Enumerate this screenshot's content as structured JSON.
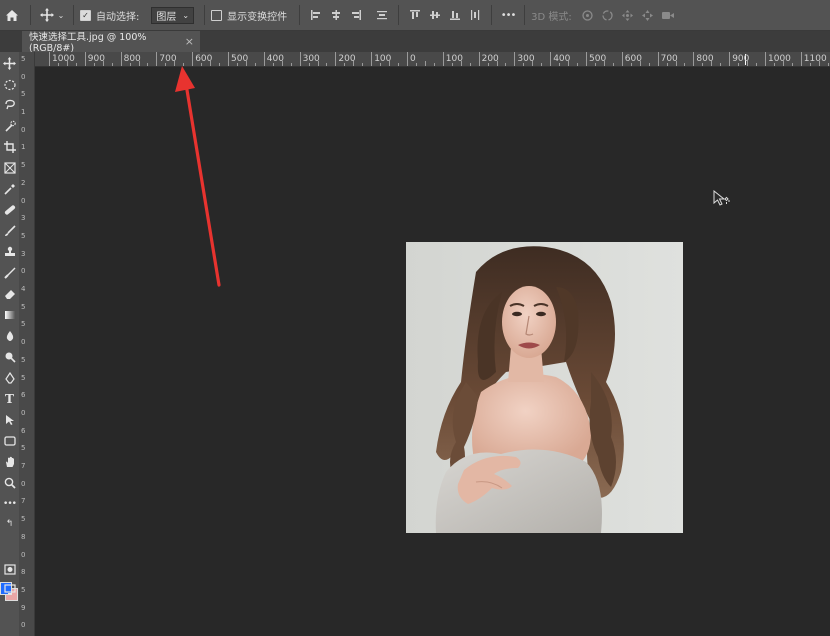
{
  "options_bar": {
    "auto_select_label": "自动选择:",
    "auto_select_checked": true,
    "layer_dropdown_value": "图层",
    "show_transform_label": "显示变换控件",
    "show_transform_checked": false,
    "mode_3d_label": "3D 模式:",
    "more_label": "•••"
  },
  "document_tab": {
    "title": "快速选择工具.jpg @ 100%(RGB/8#)",
    "close_label": "×"
  },
  "ruler": {
    "h_labels": [
      "1000",
      "900",
      "800",
      "700",
      "600",
      "500",
      "400",
      "300",
      "200",
      "100",
      "0",
      "100",
      "200",
      "300",
      "400",
      "500",
      "600",
      "700",
      "800",
      "900",
      "1000",
      "1100"
    ],
    "v_labels": [
      "5",
      "0",
      "5",
      "1",
      "0",
      "1",
      "5",
      "2",
      "0",
      "3",
      "5",
      "3",
      "0",
      "4",
      "5",
      "5",
      "0",
      "5",
      "5",
      "6",
      "0",
      "6",
      "5",
      "7",
      "0",
      "7",
      "5",
      "8",
      "0",
      "8",
      "5",
      "9",
      "0"
    ]
  },
  "tools": [
    "move-tool-icon",
    "marquee-tool-icon",
    "lasso-tool-icon",
    "quick-select-tool-icon",
    "crop-tool-icon",
    "frame-tool-icon",
    "eyedropper-tool-icon",
    "healing-tool-icon",
    "brush-tool-icon",
    "stamp-tool-icon",
    "history-brush-icon",
    "eraser-tool-icon",
    "gradient-tool-icon",
    "blur-tool-icon",
    "dodge-tool-icon",
    "pen-tool-icon",
    "type-tool-icon",
    "path-select-tool-icon",
    "shape-tool-icon",
    "hand-tool-icon",
    "zoom-tool-icon",
    "more-tools-icon"
  ],
  "colors": {
    "foreground": "#1f6bff",
    "background": "#e9a6a6",
    "annotation_arrow": "#e8332f"
  }
}
